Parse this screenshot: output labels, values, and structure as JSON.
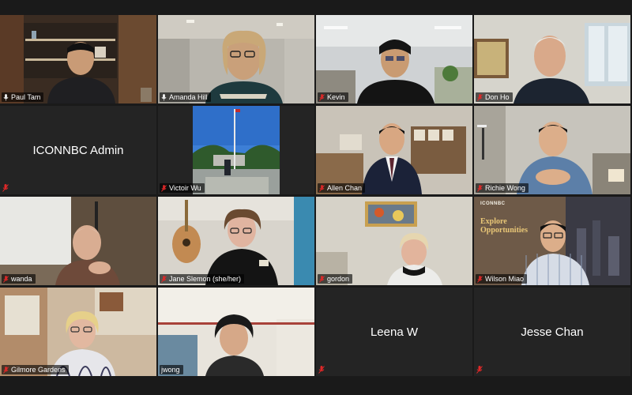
{
  "participants": [
    {
      "name": "Paul Tam",
      "muted": false,
      "video": true
    },
    {
      "name": "Amanda Hill",
      "muted": false,
      "video": true,
      "active": true
    },
    {
      "name": "Kevin",
      "muted": true,
      "video": true
    },
    {
      "name": "Don Ho",
      "muted": true,
      "video": true
    },
    {
      "name": "ICONNBC Admin",
      "muted": true,
      "video": false
    },
    {
      "name": "Victoir Wu",
      "muted": true,
      "video": true
    },
    {
      "name": "Allen Chan",
      "muted": true,
      "video": true
    },
    {
      "name": "Richie Wong",
      "muted": true,
      "video": true
    },
    {
      "name": "wanda",
      "muted": true,
      "video": true
    },
    {
      "name": "Jane Slemon (she/her)",
      "muted": true,
      "video": true
    },
    {
      "name": "gordon",
      "muted": true,
      "video": true
    },
    {
      "name": "Wilson Miao",
      "muted": true,
      "video": true
    },
    {
      "name": "Gilmore Gardens",
      "muted": true,
      "video": true
    },
    {
      "name": "jwong",
      "muted": false,
      "video": true
    },
    {
      "name": "Leena W",
      "muted": true,
      "video": false
    },
    {
      "name": "Jesse Chan",
      "muted": true,
      "video": false
    }
  ],
  "slide": {
    "logo_text": "ICONNBC",
    "headline_1": "Explore",
    "headline_2": "Opportunities"
  },
  "colors": {
    "active_border": "#e3ea7a",
    "muted_icon": "#e02828",
    "tile_bg": "#242424"
  }
}
